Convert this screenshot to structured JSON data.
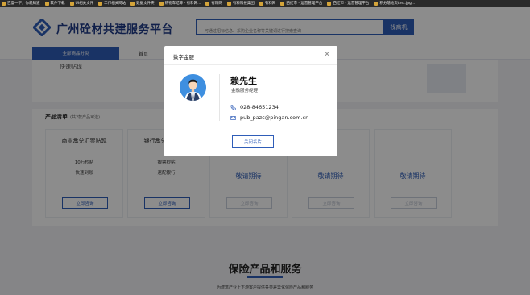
{
  "bookmarks": [
    {
      "label": "百度一下，你就知道"
    },
    {
      "label": "软件下载"
    },
    {
      "label": "UI相关文件"
    },
    {
      "label": "工作相关网站"
    },
    {
      "label": "数据文件夹"
    },
    {
      "label": "购物车结算 - 有料网..."
    },
    {
      "label": "有料网"
    },
    {
      "label": "有料科技集团"
    },
    {
      "label": "有料网"
    },
    {
      "label": "西红市 - 运营管理平台"
    },
    {
      "label": "西红市 - 运营管理平台"
    },
    {
      "label": "积分落地页test.jpg..."
    }
  ],
  "header": {
    "site_title": "广州砼材共建服务平台",
    "search_placeholder": "可通过招标信息、采购企业名称等关键词进行搜索查询",
    "search_button": "找商机"
  },
  "nav": {
    "all_categories": "全部商品分类",
    "home": "首页"
  },
  "banner": {
    "text": "快速贴现"
  },
  "products": {
    "title": "产品清单",
    "subtitle": "(共2款产品可选)",
    "cards": [
      {
        "name": "商业承兑汇票贴现",
        "lines": [
          "10万秒贴",
          "快速到账"
        ],
        "soon": "",
        "button": "立即咨询",
        "enabled": true
      },
      {
        "name": "银行承兑汇票贴现",
        "lines": [
          "银票秒贴",
          "速配银行"
        ],
        "soon": "",
        "button": "立即咨询",
        "enabled": true
      },
      {
        "name": "",
        "lines": [],
        "soon": "敬请期待",
        "button": "立即咨询",
        "enabled": false
      },
      {
        "name": "",
        "lines": [],
        "soon": "敬请期待",
        "button": "立即咨询",
        "enabled": false
      },
      {
        "name": "",
        "lines": [],
        "soon": "敬请期待",
        "button": "立即咨询",
        "enabled": false
      }
    ]
  },
  "section2": {
    "title": "保险产品和服务",
    "subtitle": "为建筑产业上下游客户提供各类差异化保险产品和服务"
  },
  "modal": {
    "title": "数字金服",
    "close_icon": "close-icon",
    "person_name": "赖先生",
    "person_role": "金融服务经理",
    "phone": "028-84651234",
    "email": "pub_pazc@pingan.com.cn",
    "close_button": "关闭名片"
  },
  "colors": {
    "brand": "#2f5db8",
    "title": "#1f3b88",
    "bookmark_bar": "#2a2a2a"
  }
}
